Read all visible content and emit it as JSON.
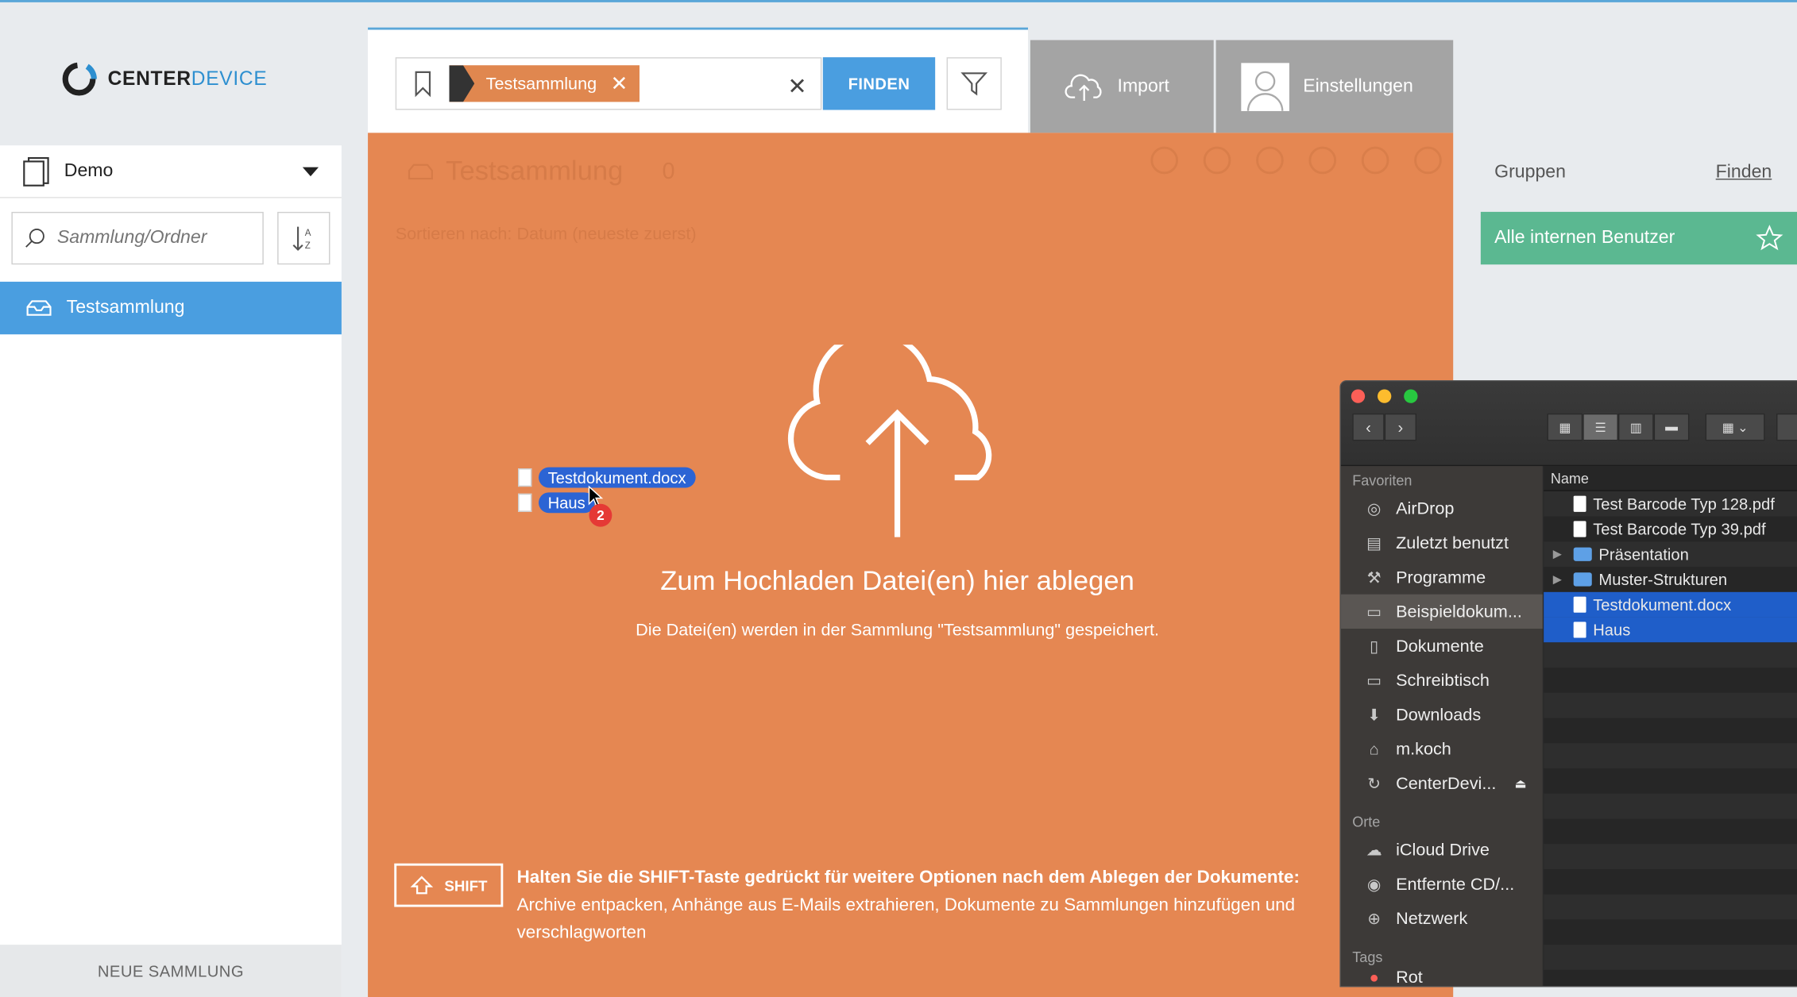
{
  "logo": {
    "part1": "CENTER",
    "part2": "DEVICE"
  },
  "sidebar": {
    "workspace": "Demo",
    "search_placeholder": "Sammlung/Ordner",
    "collection": "Testsammlung",
    "new_collection": "NEUE SAMMLUNG"
  },
  "search": {
    "tag": "Testsammlung",
    "find_label": "FINDEN"
  },
  "topbar": {
    "import_label": "Import",
    "settings_label": "Einstellungen"
  },
  "dropzone": {
    "ghost_title": "Testsammlung",
    "ghost_count": "0",
    "ghost_sort": "Sortieren nach:  Datum (neueste zuerst)",
    "title": "Zum Hochladen Datei(en) hier ablegen",
    "subtitle": "Die Datei(en) werden in der Sammlung \"Testsammlung\" gespeichert.",
    "shift_key": "SHIFT",
    "hint_bold": "Halten Sie die SHIFT-Taste gedrückt für weitere Optionen nach dem Ablegen der Dokumente:",
    "hint_text": "Archive entpacken, Anhänge aus E-Mails extrahieren, Dokumente zu Sammlungen hinzufügen und verschlagworten"
  },
  "drag": {
    "file1": "Testdokument.docx",
    "file2": "Haus",
    "count": "2"
  },
  "groups": {
    "header": "Gruppen",
    "link": "Finden",
    "item": "Alle internen Benutzer"
  },
  "finder": {
    "fav_header": "Favoriten",
    "favorites": [
      "AirDrop",
      "Zuletzt benutzt",
      "Programme",
      "Beispieldokum...",
      "Dokumente",
      "Schreibtisch",
      "Downloads",
      "m.koch",
      "CenterDevi..."
    ],
    "places_header": "Orte",
    "places": [
      "iCloud Drive",
      "Entfernte CD/...",
      "Netzwerk"
    ],
    "tags_header": "Tags",
    "tags_partial": "Rot",
    "col_name": "Name",
    "files": [
      "Test Barcode Typ 128.pdf",
      "Test Barcode Typ 39.pdf",
      "Präsentation",
      "Muster-Strukturen",
      "Testdokument.docx",
      "Haus"
    ]
  },
  "colors": {
    "accent": "#4a9ee0",
    "orange": "#e58752",
    "green": "#5bb891"
  }
}
